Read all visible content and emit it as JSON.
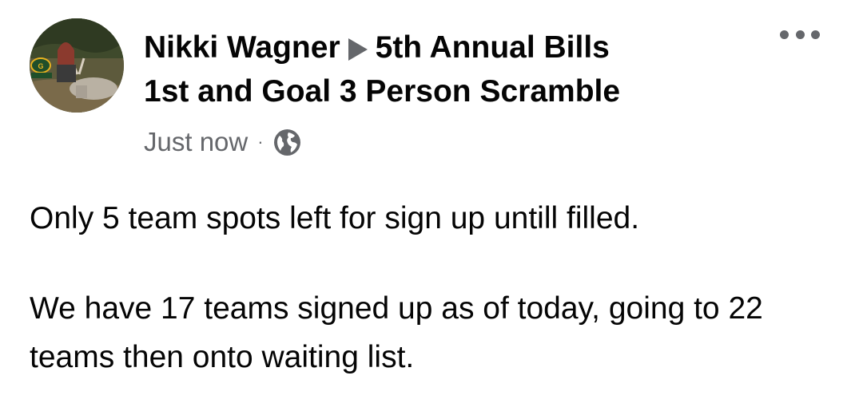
{
  "post": {
    "author": "Nikki Wagner",
    "group_line1": "5th Annual Bills",
    "group_line2": "1st and Goal 3 Person Scramble",
    "timestamp": "Just now",
    "separator": "·",
    "privacy_icon": "globe-icon",
    "menu_icon": "more-options-icon",
    "paragraphs": [
      "Only 5 team spots left for sign up untill filled.",
      "We have 17 teams signed up as of today, going to 22 teams then onto waiting list."
    ]
  },
  "colors": {
    "primary_text": "#050505",
    "secondary_text": "#65676b",
    "background": "#ffffff"
  }
}
